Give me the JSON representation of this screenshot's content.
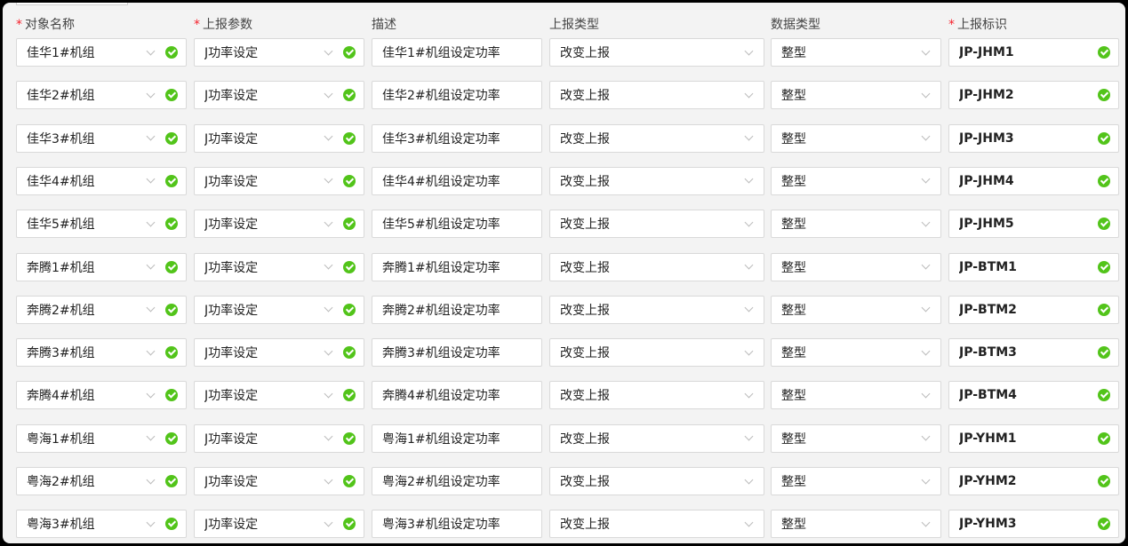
{
  "header": {
    "required_mark": "*",
    "columns": [
      "对象名称",
      "上报参数",
      "描述",
      "上报类型",
      "数据类型",
      "上报标识"
    ]
  },
  "rows": [
    {
      "object": "佳华1#机组",
      "param": "J功率设定",
      "desc": "佳华1#机组设定功率",
      "report_type": "改变上报",
      "data_type": "整型",
      "tag": "JP-JHM1"
    },
    {
      "object": "佳华2#机组",
      "param": "J功率设定",
      "desc": "佳华2#机组设定功率",
      "report_type": "改变上报",
      "data_type": "整型",
      "tag": "JP-JHM2"
    },
    {
      "object": "佳华3#机组",
      "param": "J功率设定",
      "desc": "佳华3#机组设定功率",
      "report_type": "改变上报",
      "data_type": "整型",
      "tag": "JP-JHM3"
    },
    {
      "object": "佳华4#机组",
      "param": "J功率设定",
      "desc": "佳华4#机组设定功率",
      "report_type": "改变上报",
      "data_type": "整型",
      "tag": "JP-JHM4"
    },
    {
      "object": "佳华5#机组",
      "param": "J功率设定",
      "desc": "佳华5#机组设定功率",
      "report_type": "改变上报",
      "data_type": "整型",
      "tag": "JP-JHM5"
    },
    {
      "object": "奔腾1#机组",
      "param": "J功率设定",
      "desc": "奔腾1#机组设定功率",
      "report_type": "改变上报",
      "data_type": "整型",
      "tag": "JP-BTM1"
    },
    {
      "object": "奔腾2#机组",
      "param": "J功率设定",
      "desc": "奔腾2#机组设定功率",
      "report_type": "改变上报",
      "data_type": "整型",
      "tag": "JP-BTM2"
    },
    {
      "object": "奔腾3#机组",
      "param": "J功率设定",
      "desc": "奔腾3#机组设定功率",
      "report_type": "改变上报",
      "data_type": "整型",
      "tag": "JP-BTM3"
    },
    {
      "object": "奔腾4#机组",
      "param": "J功率设定",
      "desc": "奔腾4#机组设定功率",
      "report_type": "改变上报",
      "data_type": "整型",
      "tag": "JP-BTM4"
    },
    {
      "object": "粤海1#机组",
      "param": "J功率设定",
      "desc": "粤海1#机组设定功率",
      "report_type": "改变上报",
      "data_type": "整型",
      "tag": "JP-YHM1"
    },
    {
      "object": "粤海2#机组",
      "param": "J功率设定",
      "desc": "粤海2#机组设定功率",
      "report_type": "改变上报",
      "data_type": "整型",
      "tag": "JP-YHM2"
    },
    {
      "object": "粤海3#机组",
      "param": "J功率设定",
      "desc": "粤海3#机组设定功率",
      "report_type": "改变上报",
      "data_type": "整型",
      "tag": "JP-YHM3"
    }
  ],
  "icons": {
    "select_arrow": "chevron-down-icon",
    "valid": "check-circle-icon"
  },
  "colors": {
    "required": "#f5222d",
    "valid": "#52c41a",
    "border": "#d9d9d9",
    "panel_bg": "#f3f3f3"
  }
}
